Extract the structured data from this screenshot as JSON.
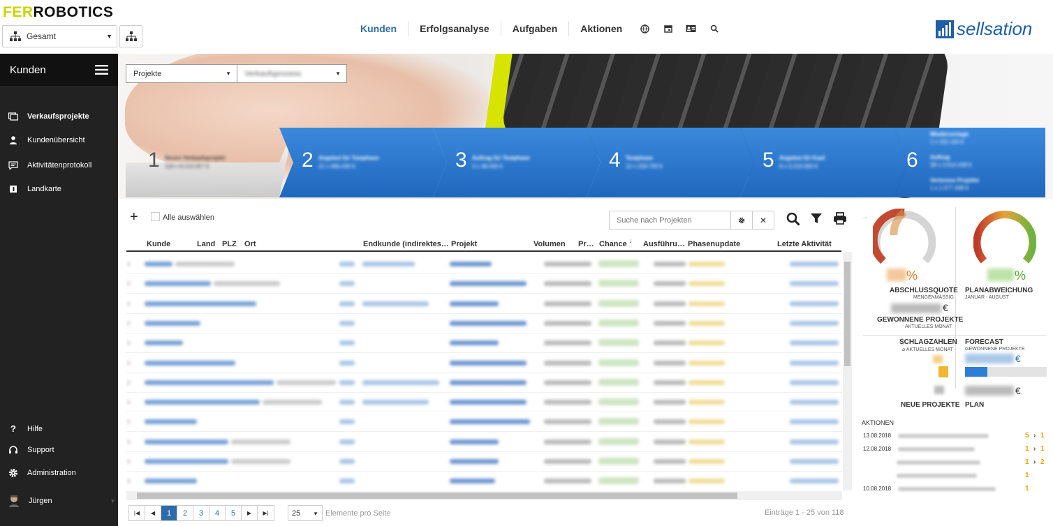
{
  "brand": {
    "logo_part1": "FER",
    "logo_part2": "ROBOTICS",
    "sellsation": "sellsation"
  },
  "org_select": {
    "value": "Gesamt"
  },
  "topnav": {
    "items": [
      "Kunden",
      "Erfolgsanalyse",
      "Aufgaben",
      "Aktionen"
    ],
    "active": "Kunden"
  },
  "sidebar": {
    "title": "Kunden",
    "items": [
      "Verkaufsprojekte",
      "Kundenübersicht",
      "Aktivitätenprotokoll",
      "Landkarte"
    ],
    "bottom_items": [
      "Hilfe",
      "Support",
      "Administration"
    ],
    "user": "Jürgen"
  },
  "filters": {
    "type": "Projekte",
    "process": "Verkaufsprozess"
  },
  "phases": [
    "1",
    "2",
    "3",
    "4",
    "5",
    "6"
  ],
  "toolbar": {
    "add": "+",
    "select_all": "Alle auswählen",
    "search_placeholder": "Suche nach Projekten"
  },
  "table": {
    "columns": [
      "Kunde",
      "Land",
      "PLZ",
      "Ort",
      "Endkunde (indirektes…",
      "Projekt",
      "Volumen",
      "Pr…",
      "Chance",
      "Ausführu…",
      "Phasenupdate",
      "Letzte Aktivität"
    ],
    "sort_indicator": "↓"
  },
  "pagination": {
    "pages": [
      "1",
      "2",
      "3",
      "4",
      "5"
    ],
    "active": "1",
    "per_page": "25",
    "per_page_label": "Elemente pro Seite",
    "entries": "Einträge 1 - 25 von 118"
  },
  "kpi": {
    "percent_sign": "%",
    "abschlussquote": "ABSCHLUSSQUOTE",
    "abschlussquote_sub": "MENGENMÄSSIG",
    "planabweichung": "PLANABWEICHUNG",
    "planabweichung_sub": "JANUAR - AUGUST",
    "currency": "€",
    "gewonnene": "GEWONNENE PROJEKTE",
    "gewonnene_sub": "AKTUELLES MONAT",
    "schlagzahlen": "SCHLAGZAHLEN",
    "schlagzahlen_sub": "⌀ AKTUELLES MONAT",
    "forecast": "FORECAST",
    "forecast_sub": "GEWONNENE PROJEKTE",
    "neue": "NEUE PROJEKTE",
    "plan": "PLAN",
    "aktionen": "AKTIONEN"
  },
  "actions": [
    {
      "date": "13.08.2018",
      "a": "5",
      "b": "1"
    },
    {
      "date": "12.08.2018",
      "a": "1",
      "b": "1"
    },
    {
      "date": "",
      "a": "1",
      "b": "2"
    },
    {
      "date": "",
      "a": "1",
      "b": ""
    },
    {
      "date": "10.08.2018",
      "a": "1",
      "b": ""
    }
  ],
  "colors": {
    "accent": "#2d6ca8",
    "sidebar": "#222222",
    "phase_blue": "#2f7fd2",
    "logo_yellow": "#c9d400",
    "action_orange": "#e9a400"
  }
}
